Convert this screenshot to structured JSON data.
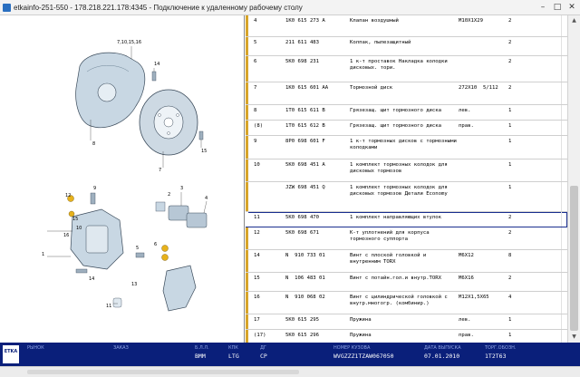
{
  "window": {
    "title": "etkainfo-251-550 - 178.218.221.178:4345 - Подключение к удаленному рабочему столу"
  },
  "illustration": {
    "callouts": [
      "7,10,15,16",
      "14",
      "8",
      "7",
      "15",
      "1",
      "2",
      "3",
      "4",
      "5",
      "6",
      "9",
      "10",
      "11",
      "12",
      "13",
      "14",
      "15",
      "16"
    ]
  },
  "parts": [
    {
      "pos": "4",
      "part": "1K0 615 273 A",
      "desc": "Клапан воздушный",
      "note": "M10X1X29",
      "qty": "2",
      "marker": "#d8a52a"
    },
    {
      "pos": "5",
      "part": "211 611 483",
      "desc": "Колпак, пылезащитный",
      "note": "",
      "qty": "2",
      "marker": "#d8a52a"
    },
    {
      "pos": "6",
      "part": "5K0 698 231",
      "desc": "1 к-т проставок Накладка колодки дисковых. тори.",
      "note": "",
      "qty": "2",
      "marker": "#d8a52a"
    },
    {
      "pos": "7",
      "part": "1K0 615 601 AA",
      "desc": "Тормозной диск",
      "note": "272X10  5/112",
      "qty": "2",
      "marker": "#d8a52a"
    },
    {
      "pos": "8",
      "part": "1T0 615 611 B",
      "desc": "Грязезащ. щит тормозного диска",
      "note": "лев.",
      "qty": "1",
      "marker": "#d8a52a"
    },
    {
      "pos": "(8)",
      "part": "1T0 615 612 B",
      "desc": "Грязезащ. щит тормозного диска",
      "note": "прав.",
      "qty": "1",
      "marker": "#d8a52a"
    },
    {
      "pos": "9",
      "part": "8P0 698 601 F",
      "desc": "1 к-т тормозных дисков с тормозными колодками",
      "note": "",
      "qty": "1",
      "marker": "#d8a52a"
    },
    {
      "pos": "10",
      "part": "5K0 698 451 A",
      "desc": "1 комплект тормозных колодок для дисковых тормозов",
      "note": "",
      "qty": "1",
      "marker": "#d8a52a"
    },
    {
      "pos": "",
      "part": "JZW 698 451 Q",
      "desc": "1 комплект тормозных колодок для дисковых тормозов Детали Economy",
      "note": "",
      "qty": "1",
      "marker": "#d8a52a"
    },
    {
      "pos": "11",
      "part": "5K0 698 470",
      "desc": "1 комплект направляющих втулок",
      "note": "",
      "qty": "2",
      "marker": "#ffffff",
      "selected": true
    },
    {
      "pos": "12",
      "part": "5K0 698 671",
      "desc": "К-т уплотнений для корпуса тормозного суппорта",
      "note": "",
      "qty": "2",
      "marker": "#d8a52a"
    },
    {
      "pos": "14",
      "part": "N  910 733 01",
      "desc": "Винт с плоской головкой и внутренним TORX",
      "note": "M6X12",
      "qty": "8",
      "marker": "#d8a52a"
    },
    {
      "pos": "15",
      "part": "N  106 483 01",
      "desc": "Винт с потайн.гол.и внутр.TORX",
      "note": "M6X16",
      "qty": "2",
      "marker": "#d8a52a"
    },
    {
      "pos": "16",
      "part": "N  910 068 02",
      "desc": "Винт с цилиндрической головкой с внутр.многогр. (комбинир.)",
      "note": "M12X1,5X65",
      "qty": "4",
      "marker": "#d8a52a"
    },
    {
      "pos": "17",
      "part": "5K0 615 295",
      "desc": "Пружина",
      "note": "лев.",
      "qty": "1",
      "marker": "#d8a52a"
    },
    {
      "pos": "(17)",
      "part": "5K0 615 296",
      "desc": "Пружина",
      "note": "прав.",
      "qty": "1",
      "marker": "#d8a52a"
    }
  ],
  "statusbar": {
    "logo": "ETKA",
    "fields": [
      {
        "label": "РЫНОК",
        "value": ""
      },
      {
        "label": "ЗАКАЗ",
        "value": ""
      },
      {
        "label": "Б.Л.Л.",
        "value": "BMM"
      },
      {
        "label": "КПК",
        "value": "LTG"
      },
      {
        "label": "ДГ",
        "value": "CP"
      },
      {
        "label": "НОМЕР КУЗОВА",
        "value": "WVGZZZ1TZAW067050"
      },
      {
        "label": "ДАТА ВЫПУСКА",
        "value": "07.01.2010"
      },
      {
        "label": "ТОРГ.ОБОЗН.",
        "value": "1T2T63"
      }
    ]
  }
}
